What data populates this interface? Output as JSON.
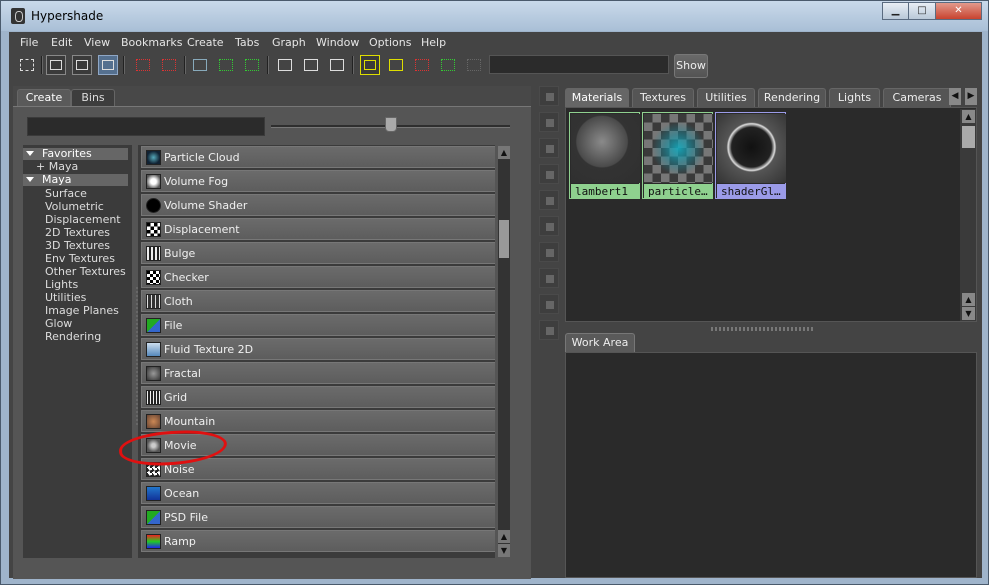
{
  "window": {
    "title": "Hypershade",
    "controls": {
      "minimize": "▁",
      "maximize": "□",
      "close": "✕"
    }
  },
  "menubar": [
    "File",
    "Edit",
    "View",
    "Bookmarks",
    "Create",
    "Tabs",
    "Graph",
    "Window",
    "Options",
    "Help"
  ],
  "toolbar": {
    "show_label": "Show",
    "search_value": ""
  },
  "left_panel": {
    "tabs": [
      "Create",
      "Bins"
    ],
    "active_tab": "Create",
    "filter_value": "",
    "tree": {
      "favorites_header": "Favorites",
      "favorites_items": [
        "+ Maya"
      ],
      "maya_header": "Maya",
      "maya_items": [
        "Surface",
        "Volumetric",
        "Displacement",
        "2D Textures",
        "3D Textures",
        "Env Textures",
        "Other Textures",
        "Lights",
        "Utilities",
        "Image Planes",
        "Glow",
        "Rendering"
      ]
    },
    "nodes": [
      {
        "label": "Particle Cloud",
        "icon": "particle-cloud-icon"
      },
      {
        "label": "Volume Fog",
        "icon": "volume-fog-icon"
      },
      {
        "label": "Volume Shader",
        "icon": "volume-shader-icon"
      },
      {
        "label": "Displacement",
        "icon": "displacement-icon"
      },
      {
        "label": "Bulge",
        "icon": "bulge-icon"
      },
      {
        "label": "Checker",
        "icon": "checker-icon"
      },
      {
        "label": "Cloth",
        "icon": "cloth-icon"
      },
      {
        "label": "File",
        "icon": "file-icon"
      },
      {
        "label": "Fluid Texture 2D",
        "icon": "fluid-texture-icon"
      },
      {
        "label": "Fractal",
        "icon": "fractal-icon"
      },
      {
        "label": "Grid",
        "icon": "grid-icon"
      },
      {
        "label": "Mountain",
        "icon": "mountain-icon"
      },
      {
        "label": "Movie",
        "icon": "movie-icon"
      },
      {
        "label": "Noise",
        "icon": "noise-icon"
      },
      {
        "label": "Ocean",
        "icon": "ocean-icon"
      },
      {
        "label": "PSD File",
        "icon": "psd-file-icon"
      },
      {
        "label": "Ramp",
        "icon": "ramp-icon"
      }
    ]
  },
  "right_panel": {
    "tabs": [
      "Materials",
      "Textures",
      "Utilities",
      "Rendering",
      "Lights",
      "Cameras"
    ],
    "active_tab": "Materials",
    "materials": [
      {
        "name": "lambert1",
        "label_color": "#8fd18f"
      },
      {
        "name": "particle…",
        "label_color": "#8fd18f"
      },
      {
        "name": "shaderGl…",
        "label_color": "#9b9be8"
      }
    ],
    "work_area_tab": "Work Area"
  },
  "colors": {
    "background": "#444444",
    "annotation": "#e01010"
  }
}
